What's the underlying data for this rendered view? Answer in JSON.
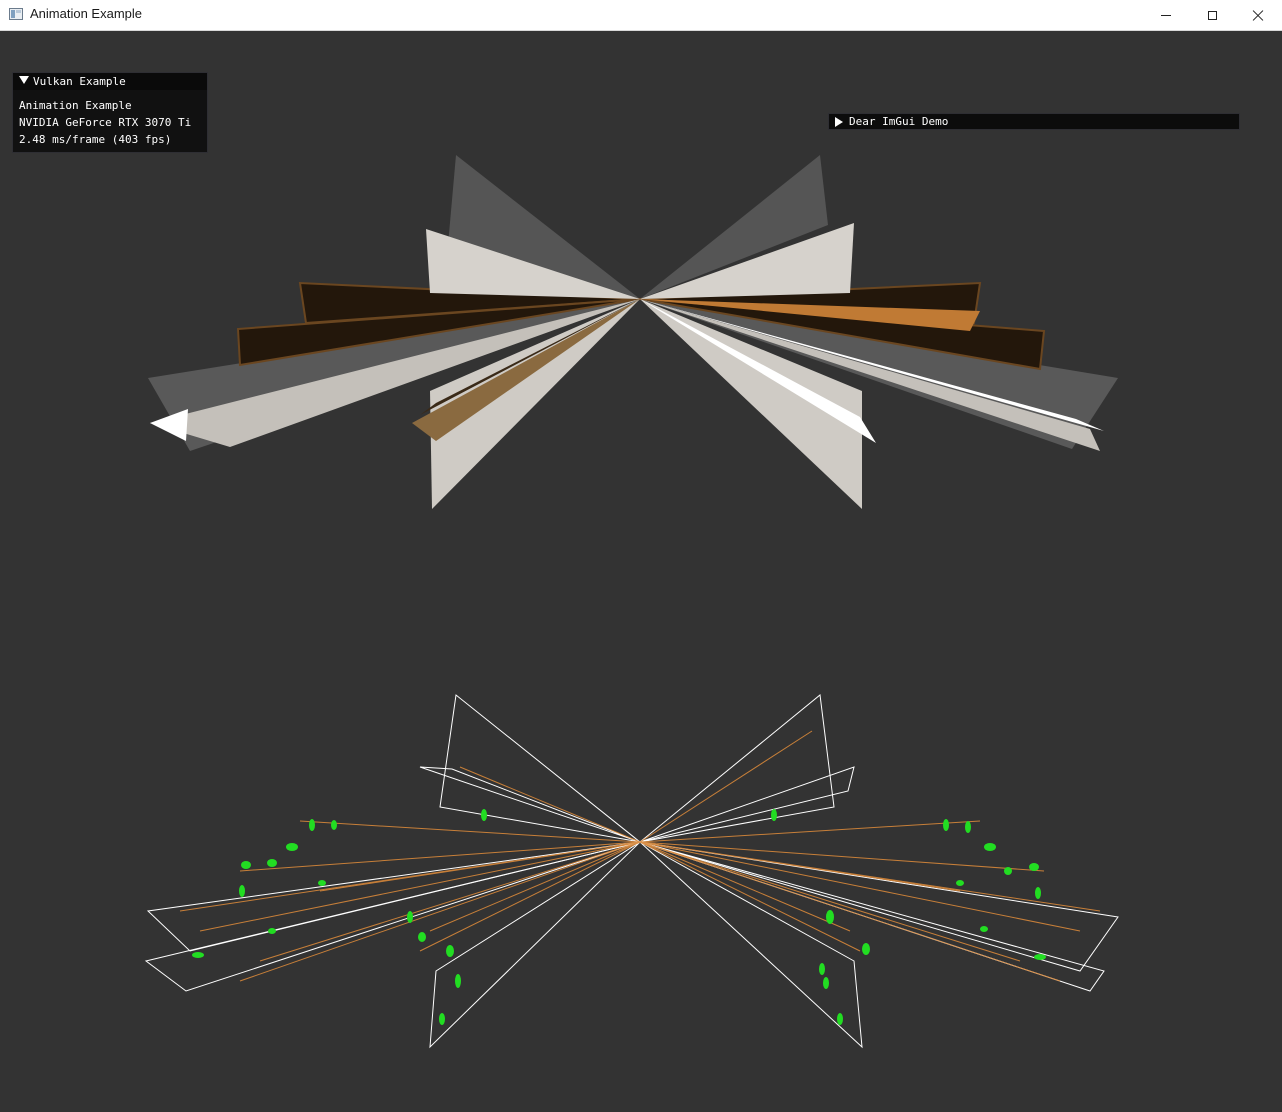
{
  "window": {
    "title": "Animation Example",
    "icon": "app-window-icon",
    "controls": [
      "minimize-icon",
      "maximize-icon",
      "close-icon"
    ]
  },
  "imgui": {
    "vulkan_panel": {
      "title": "Vulkan Example",
      "lines": [
        "Animation Example",
        "NVIDIA GeForce RTX 3070 Ti",
        "2.48 ms/frame (403 fps)"
      ]
    },
    "demo_window": {
      "title": "Dear ImGui Demo"
    }
  },
  "colors": {
    "background": "#333333",
    "panel_bg": "#0f0f0f",
    "light_face": "#d6d2cc",
    "grey_face": "#555555",
    "dark_face": "#23170b",
    "bone_orange": "#d8883a",
    "wire_white": "#ffffff",
    "joint_green": "#22dd22"
  }
}
